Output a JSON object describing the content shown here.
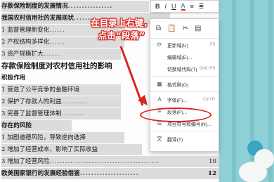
{
  "doc_lines": [
    {
      "text": "存款保险制度的发展情况",
      "dots": "................",
      "page": "",
      "style": "hl bold"
    },
    {
      "text": "我国农村信用社的发展现状",
      "dots": ".......",
      "page": "",
      "style": "hl bold"
    },
    {
      "text": "1 监督管理新变化",
      "dots": "......",
      "page": "",
      "style": "hl"
    },
    {
      "text": "2 产权结构多样化",
      "dots": "......",
      "page": "",
      "style": "hl"
    },
    {
      "text": "3 资产规模扩大",
      "dots": ".......",
      "page": "",
      "style": "hl"
    },
    {
      "text": "存款保险制度对农村信用社的影响",
      "dots": "",
      "page": "",
      "style": "big"
    },
    {
      "text": "积极作用",
      "dots": "",
      "page": "",
      "style": "bold"
    },
    {
      "text": "1 营造了公平竞争的金融环境",
      "dots": "",
      "page": "",
      "style": "hl"
    },
    {
      "text": "2 保护了存款人的利益",
      "dots": "..........",
      "page": "",
      "style": "hl"
    },
    {
      "text": "3 完善了监督管理体制",
      "dots": ".........",
      "page": "",
      "style": "hl"
    },
    {
      "text": "存在的风险",
      "dots": "",
      "page": "",
      "style": "hl bold"
    },
    {
      "text": "1 加剧道德风险，导致逆向选择",
      "dots": "",
      "page": "",
      "style": "hl"
    },
    {
      "text": "2 增加了经营成本，影响了实际收益",
      "dots": "",
      "page": "",
      "style": "hl"
    },
    {
      "text": "3 增加了经营风险",
      "dots": "..........................................",
      "page": "10",
      "style": "hl"
    },
    {
      "text": "欧美国家银行的发展经验借鉴",
      "dots": ".....................",
      "page": "12",
      "style": "hl bold"
    }
  ],
  "callout": {
    "line1": "在目录上右键，",
    "line2": "点击“段落”"
  },
  "toolbar": {
    "items": [
      "B",
      "I",
      "U",
      "A",
      "≡",
      "≣"
    ]
  },
  "menu_top_icons": [
    "copy-icon",
    "paste-icon",
    "cut-icon",
    "paste-special-icon"
  ],
  "menu": [
    {
      "icon": "⟳",
      "label": "更新域(U)",
      "shortcut": "F9"
    },
    {
      "icon": "",
      "label": "编辑域(E)...",
      "shortcut": ""
    },
    {
      "icon": "",
      "label": "切换域代码(T)",
      "shortcut": "Shift+F9"
    },
    {
      "sep": true
    },
    {
      "icon": "▦",
      "label": "格式刷(O)",
      "shortcut": ""
    },
    {
      "sep": true
    },
    {
      "icon": "A",
      "label": "字体(F)...",
      "shortcut": "Ctrl+D"
    },
    {
      "icon": "≡",
      "label": "段落(P)...",
      "shortcut": ""
    },
    {
      "icon": "☰",
      "label": "项目符号和编号(N)...",
      "shortcut": ""
    },
    {
      "sep": true
    },
    {
      "icon": "文",
      "label": "翻译(T)",
      "shortcut": ""
    }
  ],
  "colors": {
    "accent": "#d5281f",
    "background": "#8fd0d6"
  }
}
